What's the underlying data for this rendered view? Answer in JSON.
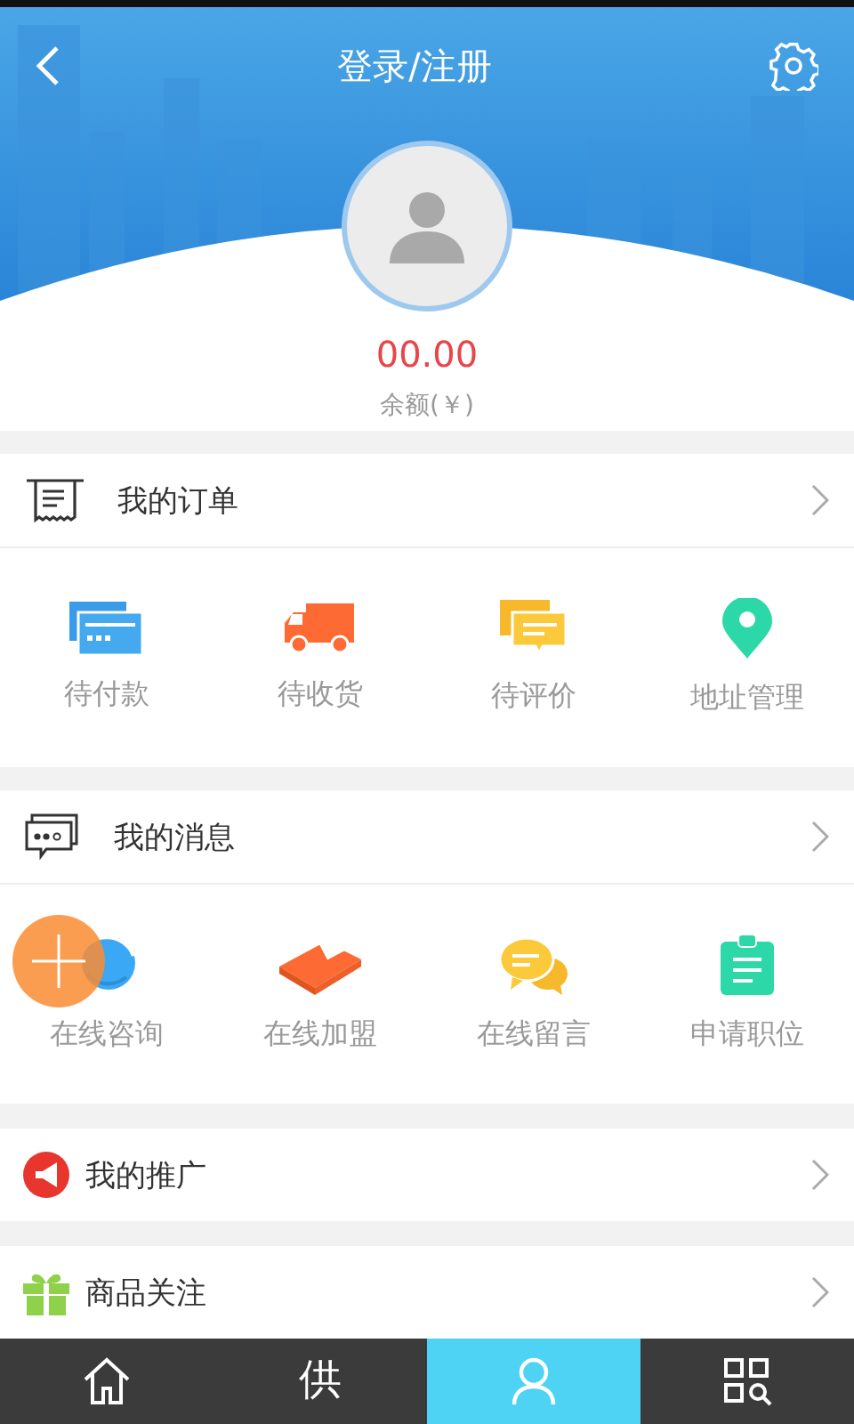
{
  "header": {
    "title": "登录/注册",
    "balance": "00.00",
    "balance_label": "余额(￥)"
  },
  "sections": [
    {
      "title": "我的订单",
      "kind": "orders",
      "items": [
        {
          "label": "待付款",
          "kind": "card"
        },
        {
          "label": "待收货",
          "kind": "truck"
        },
        {
          "label": "待评价",
          "kind": "comment"
        },
        {
          "label": "地址管理",
          "kind": "pin"
        }
      ]
    },
    {
      "title": "我的消息",
      "kind": "messages",
      "items": [
        {
          "label": "在线咨询",
          "kind": "bubble"
        },
        {
          "label": "在线加盟",
          "kind": "package"
        },
        {
          "label": "在线留言",
          "kind": "chats"
        },
        {
          "label": "申请职位",
          "kind": "clipboard"
        }
      ]
    }
  ],
  "rows": [
    {
      "title": "我的推广",
      "kind": "promo"
    },
    {
      "title": "商品关注",
      "kind": "gift"
    }
  ],
  "nav": [
    {
      "kind": "home",
      "selected": false
    },
    {
      "kind": "glyph",
      "glyph": "供",
      "selected": false
    },
    {
      "kind": "person",
      "selected": true
    },
    {
      "kind": "scan",
      "selected": false
    }
  ]
}
